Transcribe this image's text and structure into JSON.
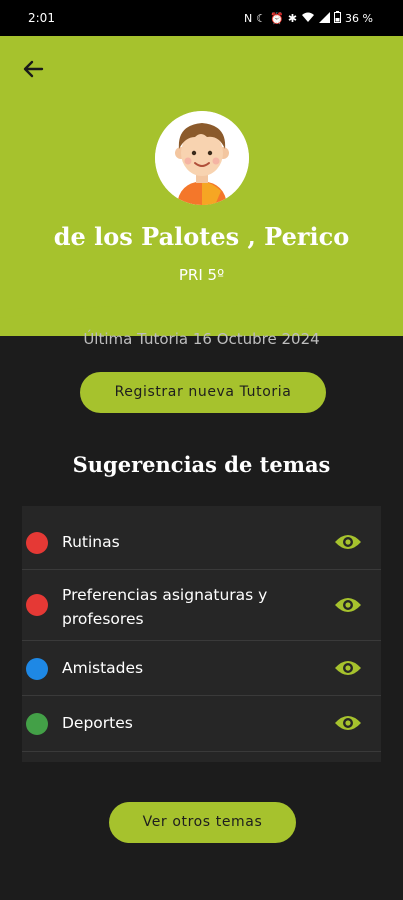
{
  "status_bar": {
    "time": "2:01",
    "battery": "36 %"
  },
  "header": {
    "student_name": "de los Palotes , Perico",
    "grade": "PRI 5º",
    "background_color": "#a6c22d"
  },
  "last_tutoria": "Última Tutoria 16 Octubre 2024",
  "register_button": "Registrar nueva Tutoria",
  "suggestions": {
    "title": "Sugerencias de temas",
    "items": [
      {
        "label": "Rutinas",
        "color": "#e53935"
      },
      {
        "label": "Preferencias asignaturas y profesores",
        "color": "#e53935"
      },
      {
        "label": "Amistades",
        "color": "#1e88e5"
      },
      {
        "label": "Deportes",
        "color": "#43a047"
      }
    ]
  },
  "more_topics_button": "Ver otros temas",
  "icons": {
    "back": "arrow-left-icon",
    "view": "eye-icon"
  }
}
